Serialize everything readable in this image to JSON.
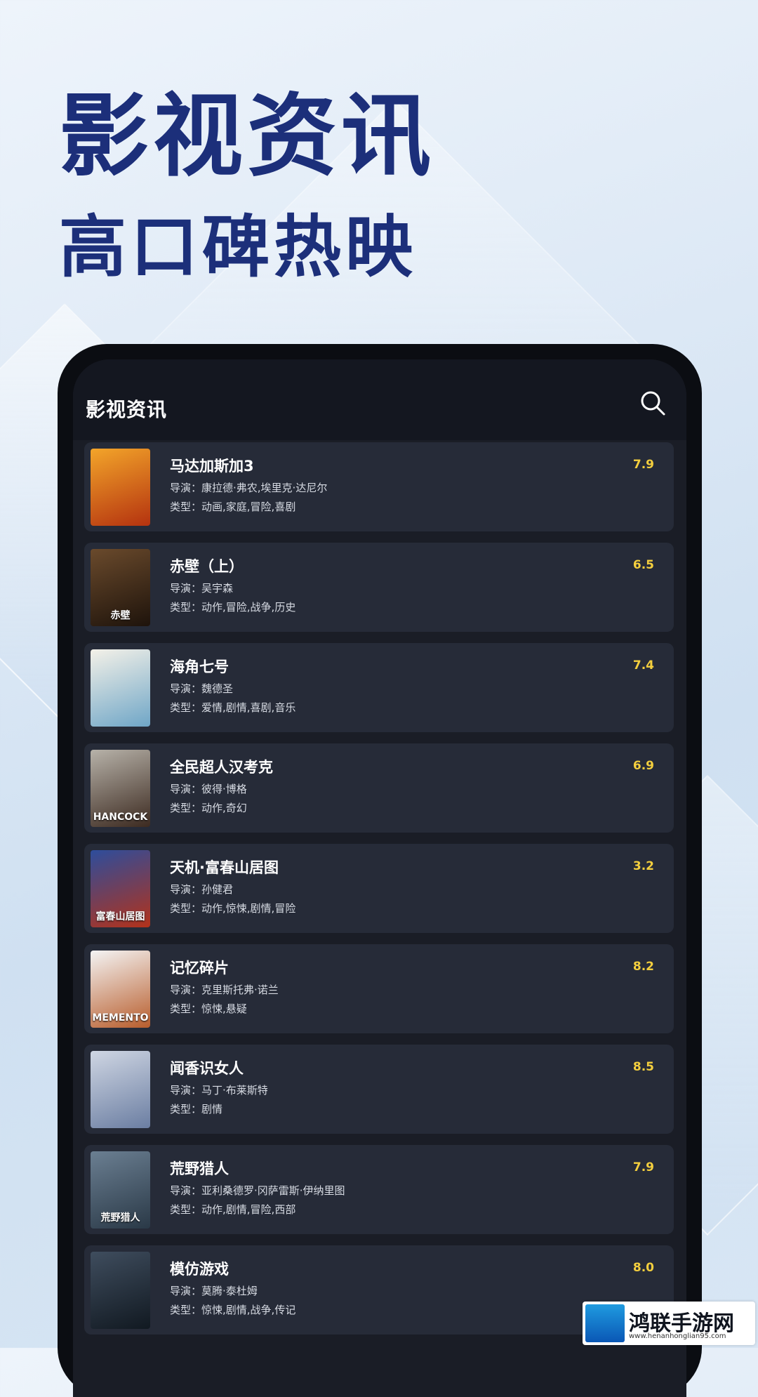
{
  "hero": {
    "title": "影视资讯",
    "subtitle": "高口碑热映"
  },
  "app": {
    "title": "影视资讯",
    "search_icon": "search-icon"
  },
  "labels": {
    "director": "导演：",
    "genre": "类型："
  },
  "movies": [
    {
      "title": "马达加斯加3",
      "director": "康拉德·弗农,埃里克·达尼尔",
      "genre": "动画,家庭,冒险,喜剧",
      "score": "7.9",
      "colors": [
        "#f3a52a",
        "#b4320f"
      ],
      "cap": ""
    },
    {
      "title": "赤壁（上）",
      "director": "吴宇森",
      "genre": "动作,冒险,战争,历史",
      "score": "6.5",
      "colors": [
        "#6a4a2c",
        "#1e130b"
      ],
      "cap": "赤壁"
    },
    {
      "title": "海角七号",
      "director": "魏德圣",
      "genre": "爱情,剧情,喜剧,音乐",
      "score": "7.4",
      "colors": [
        "#f4f1e8",
        "#6fa6c7"
      ],
      "cap": ""
    },
    {
      "title": "全民超人汉考克",
      "director": "彼得·博格",
      "genre": "动作,奇幻",
      "score": "6.9",
      "colors": [
        "#b7b2a9",
        "#3c2a20"
      ],
      "cap": "HANCOCK"
    },
    {
      "title": "天机·富春山居图",
      "director": "孙健君",
      "genre": "动作,惊悚,剧情,冒险",
      "score": "3.2",
      "colors": [
        "#2d4d9c",
        "#b3321a"
      ],
      "cap": "富春山居图"
    },
    {
      "title": "记忆碎片",
      "director": "克里斯托弗·诺兰",
      "genre": "惊悚,悬疑",
      "score": "8.2",
      "colors": [
        "#f4f4f4",
        "#b85d2c"
      ],
      "cap": "MEMENTO"
    },
    {
      "title": "闻香识女人",
      "director": "马丁·布莱斯特",
      "genre": "剧情",
      "score": "8.5",
      "colors": [
        "#cfd6e3",
        "#6b7ea2"
      ],
      "cap": ""
    },
    {
      "title": "荒野猎人",
      "director": "亚利桑德罗·冈萨雷斯·伊纳里图",
      "genre": "动作,剧情,冒险,西部",
      "score": "7.9",
      "colors": [
        "#6b7f92",
        "#2a3947"
      ],
      "cap": "荒野猎人"
    },
    {
      "title": "模仿游戏",
      "director": "莫腾·泰杜姆",
      "genre": "惊悚,剧情,战争,传记",
      "score": "8.0",
      "colors": [
        "#3f4d5e",
        "#111921"
      ],
      "cap": ""
    }
  ],
  "watermark": {
    "name": "鸿联手游网",
    "url": "www.henanhonglian95.com"
  }
}
